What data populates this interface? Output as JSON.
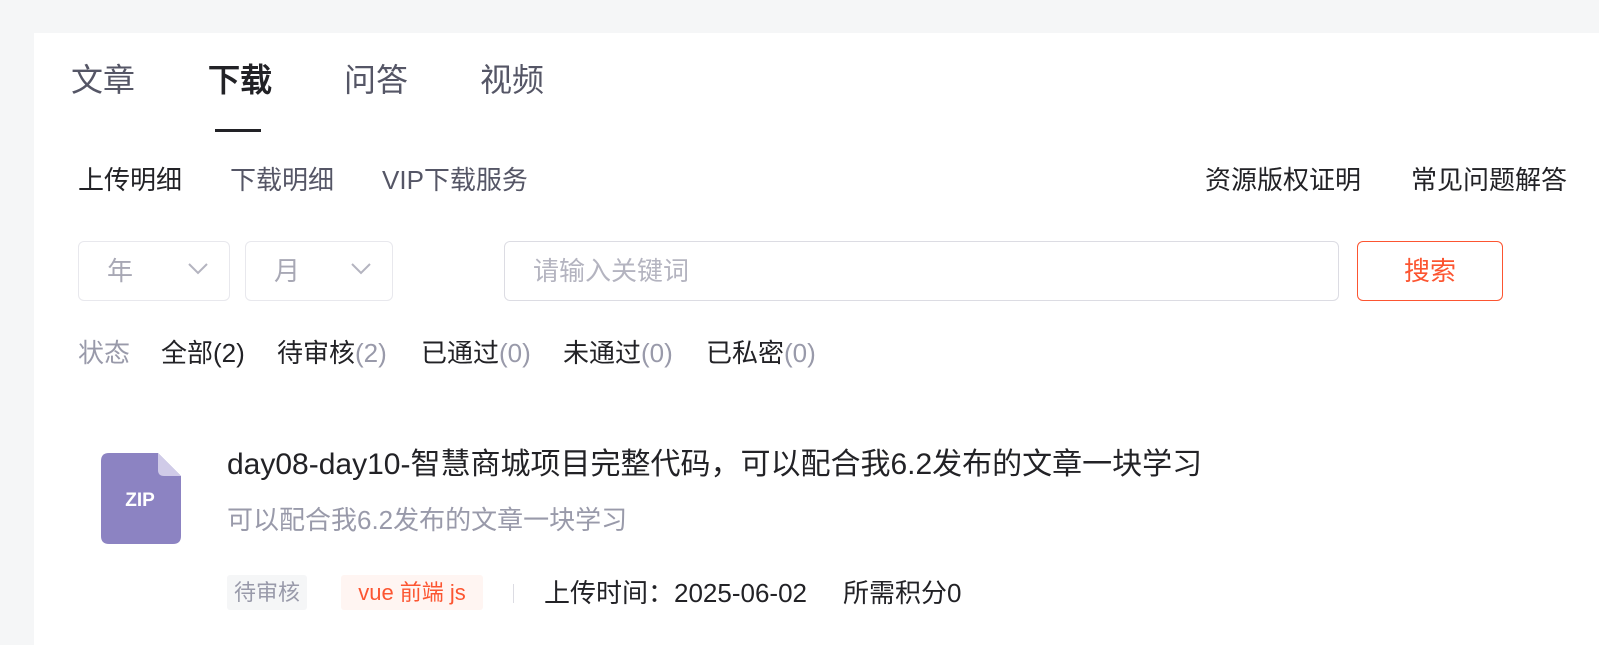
{
  "tabs": [
    {
      "label": "文章",
      "active": false
    },
    {
      "label": "下载",
      "active": true
    },
    {
      "label": "问答",
      "active": false
    },
    {
      "label": "视频",
      "active": false
    }
  ],
  "subnav": {
    "left": [
      "上传明细",
      "下载明细",
      "VIP下载服务"
    ],
    "right": [
      "资源版权证明",
      "常见问题解答"
    ]
  },
  "filters": {
    "year_placeholder": "年",
    "month_placeholder": "月",
    "search_placeholder": "请输入关键词",
    "search_button": "搜索"
  },
  "status": {
    "label": "状态",
    "items": [
      {
        "name": "全部",
        "count": "(2)",
        "active": true
      },
      {
        "name": "待审核",
        "count": "(2)",
        "active": false
      },
      {
        "name": "已通过",
        "count": "(0)",
        "active": false
      },
      {
        "name": "未通过",
        "count": "(0)",
        "active": false
      },
      {
        "name": "已私密",
        "count": "(0)",
        "active": false
      }
    ]
  },
  "resource": {
    "file_type": "ZIP",
    "title": "day08-day10-智慧商城项目完整代码，可以配合我6.2发布的文章一块学习",
    "description": "可以配合我6.2发布的文章一块学习",
    "status_tag": "待审核",
    "keyword_tag": "vue 前端 js",
    "upload_time": "上传时间：2025-06-02",
    "points": "所需积分0"
  },
  "colors": {
    "accent": "#fc5531",
    "zip_icon": "#8c83c2",
    "page_bg": "#f5f6f7"
  },
  "icons": [
    "chevron-down-icon",
    "zip-file-icon"
  ]
}
